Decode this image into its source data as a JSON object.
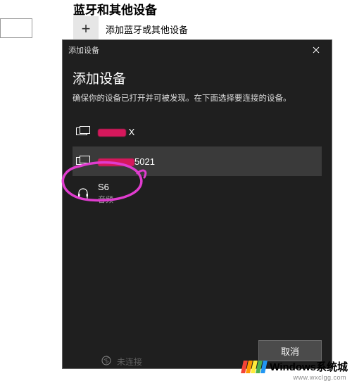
{
  "background": {
    "page_title_cut": "蓝牙和其他设备",
    "add_bluetooth_label": "添加蓝牙或其他设备",
    "status_text": "未连接"
  },
  "dialog": {
    "titlebar": "添加设备",
    "heading": "添加设备",
    "subtitle": "确保你的设备已打开并可被发现。在下面选择要连接的设备。",
    "devices": [
      {
        "name_visible_suffix": "X",
        "subtype": "display",
        "redacted": true
      },
      {
        "name_visible_suffix": "5021",
        "subtype": "display",
        "redacted": true,
        "selected": true
      },
      {
        "name": "S6",
        "sub": "音频",
        "subtype": "audio"
      }
    ],
    "cancel": "取消"
  },
  "annotation": {
    "circle_color": "#e03ccf"
  },
  "watermark": {
    "text": "Windows系统城",
    "sub": "www.wxclgg.com",
    "flag_colors": [
      "#f44336",
      "#ff9800",
      "#ffeb3b",
      "#4caf50",
      "#2196f3"
    ]
  }
}
